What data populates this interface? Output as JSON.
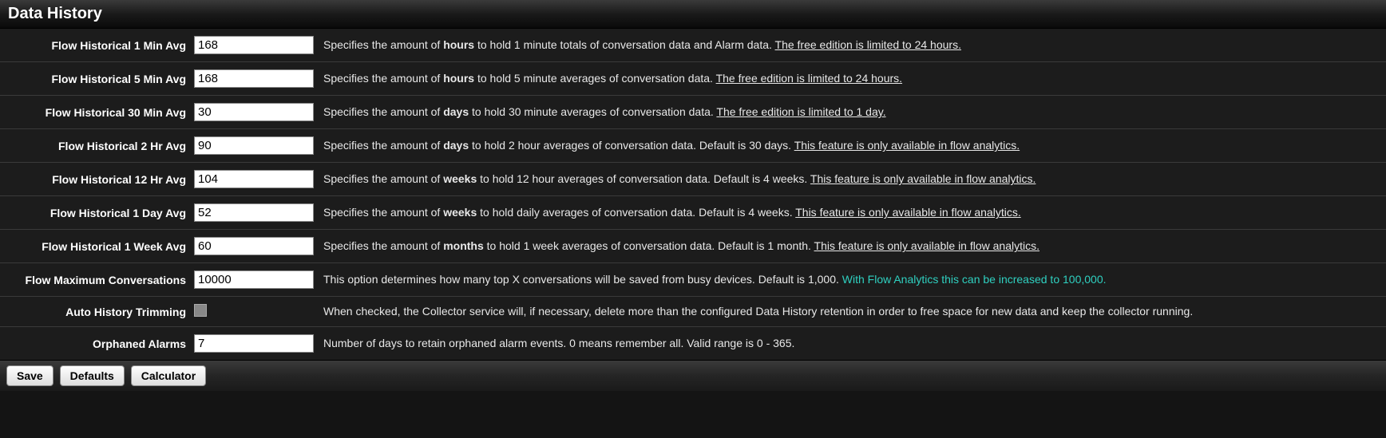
{
  "header": {
    "title": "Data History"
  },
  "rows": [
    {
      "id": "flow-1min",
      "label": "Flow Historical 1 Min Avg",
      "value": "168",
      "desc_pre": "Specifies the amount of ",
      "desc_bold": "hours",
      "desc_post": " to hold 1 minute totals of conversation data and Alarm data. ",
      "desc_link": "The free edition is limited to 24 hours."
    },
    {
      "id": "flow-5min",
      "label": "Flow Historical 5 Min Avg",
      "value": "168",
      "desc_pre": "Specifies the amount of ",
      "desc_bold": "hours",
      "desc_post": " to hold 5 minute averages of conversation data. ",
      "desc_link": "The free edition is limited to 24 hours."
    },
    {
      "id": "flow-30min",
      "label": "Flow Historical 30 Min Avg",
      "value": "30",
      "desc_pre": "Specifies the amount of ",
      "desc_bold": "days",
      "desc_post": " to hold 30 minute averages of conversation data. ",
      "desc_link": "The free edition is limited to 1 day."
    },
    {
      "id": "flow-2hr",
      "label": "Flow Historical 2 Hr Avg",
      "value": "90",
      "desc_pre": "Specifies the amount of ",
      "desc_bold": "days",
      "desc_post": " to hold 2 hour averages of conversation data. Default is 30 days. ",
      "desc_link": "This feature is only available in flow analytics."
    },
    {
      "id": "flow-12hr",
      "label": "Flow Historical 12 Hr Avg",
      "value": "104",
      "desc_pre": "Specifies the amount of ",
      "desc_bold": "weeks",
      "desc_post": " to hold 12 hour averages of conversation data. Default is 4 weeks. ",
      "desc_link": "This feature is only available in flow analytics."
    },
    {
      "id": "flow-1day",
      "label": "Flow Historical 1 Day Avg",
      "value": "52",
      "desc_pre": "Specifies the amount of ",
      "desc_bold": "weeks",
      "desc_post": " to hold daily averages of conversation data. Default is 4 weeks. ",
      "desc_link": "This feature is only available in flow analytics."
    },
    {
      "id": "flow-1week",
      "label": "Flow Historical 1 Week Avg",
      "value": "60",
      "desc_pre": "Specifies the amount of ",
      "desc_bold": "months",
      "desc_post": " to hold 1 week averages of conversation data. Default is 1 month. ",
      "desc_link": "This feature is only available in flow analytics."
    }
  ],
  "maxconv": {
    "label": "Flow Maximum Conversations",
    "value": "10000",
    "desc_pre": "This option determines how many top X conversations will be saved from busy devices. Default is 1,000. ",
    "desc_teal": "With Flow Analytics this can be increased to 100,000."
  },
  "autotrim": {
    "label": "Auto History Trimming",
    "desc": "When checked, the Collector service will, if necessary, delete more than the configured Data History retention in order to free space for new data and keep the collector running."
  },
  "orphaned": {
    "label": "Orphaned Alarms",
    "value": "7",
    "desc": "Number of days to retain orphaned alarm events. 0 means remember all. Valid range is 0 - 365."
  },
  "footer": {
    "save": "Save",
    "defaults": "Defaults",
    "calculator": "Calculator"
  }
}
